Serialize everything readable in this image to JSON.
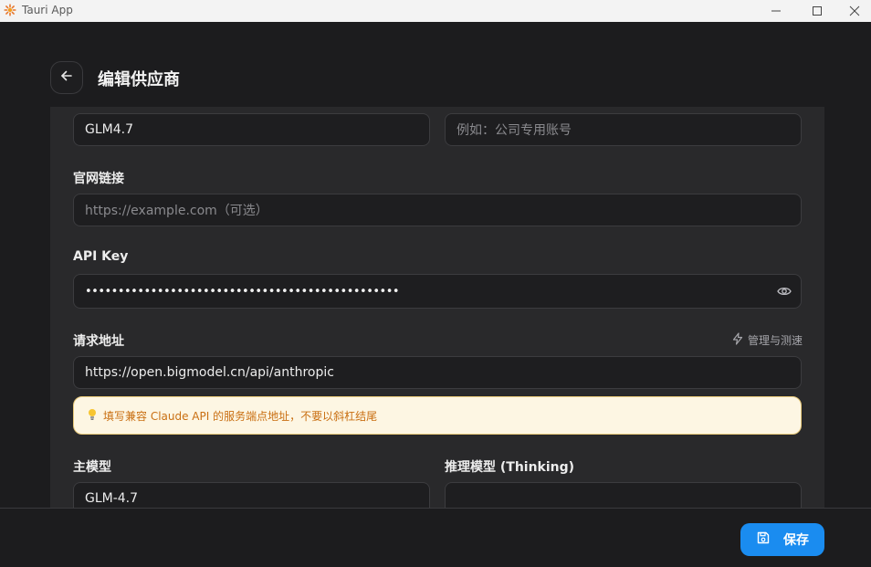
{
  "window": {
    "title": "Tauri App",
    "icons": {
      "app": "tauri-logo-icon",
      "minimize": "minimize-icon",
      "maximize": "maximize-icon",
      "close": "close-icon"
    }
  },
  "header": {
    "back_icon": "arrow-left-icon",
    "title": "编辑供应商"
  },
  "form": {
    "name_value": "GLM4.7",
    "note_placeholder": "例如：公司专用账号",
    "website_label": "官网链接",
    "website_placeholder": "https://example.com（可选）",
    "api_key_label": "API Key",
    "api_key_masked": "••••••••••••••••••••••••••••••••••••••••••••••••",
    "api_key_toggle_icon": "eye-icon",
    "endpoint_label": "请求地址",
    "endpoint_action": "管理与测速",
    "endpoint_action_icon": "lightning-icon",
    "endpoint_value": "https://open.bigmodel.cn/api/anthropic",
    "hint_icon": "lightbulb-icon",
    "hint_text": "填写兼容 Claude API 的服务端点地址，不要以斜杠结尾",
    "main_model_label": "主模型",
    "main_model_value": "GLM-4.7",
    "thinking_model_label": "推理模型 (Thinking)",
    "thinking_model_value": ""
  },
  "footer": {
    "save_icon": "save-icon",
    "save_label": "保存"
  },
  "colors": {
    "background": "#1c1c1e",
    "panel": "#29292b",
    "accent": "#1a8cf0",
    "hint_bg": "#fdf6e3",
    "hint_text": "#c96f12"
  }
}
